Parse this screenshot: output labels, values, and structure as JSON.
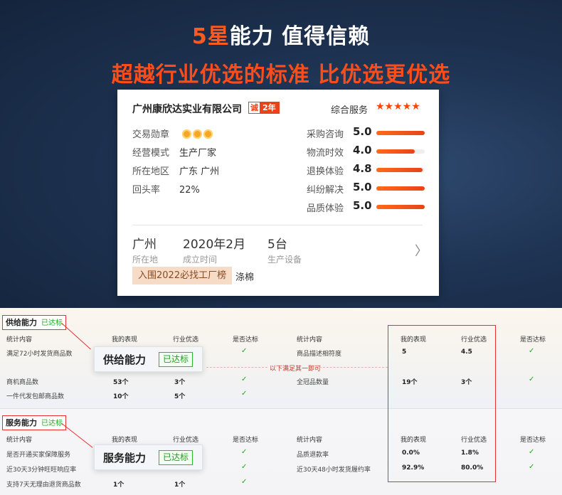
{
  "banner": {
    "headline1_accent": "5星",
    "headline1_rest": "能力 值得信赖",
    "headline2": "超越行业优选的标准  比优选更优选"
  },
  "card": {
    "company_name": "广州康欣达实业有限公司",
    "badge_cheng": "诚",
    "badge_years": "2年",
    "service_label": "综合服务",
    "service_stars": "★★★★★",
    "info": [
      {
        "key": "交易勋章",
        "value": ""
      },
      {
        "key": "经营模式",
        "value": "生产厂家"
      },
      {
        "key": "所在地区",
        "value": "广东 广州"
      },
      {
        "key": "回头率",
        "value": "22%"
      }
    ],
    "medal_count": 3,
    "scores": [
      {
        "label": "采购咨询",
        "value": "5.0",
        "fraction": 1.0
      },
      {
        "label": "物流时效",
        "value": "4.0",
        "fraction": 0.8
      },
      {
        "label": "退换体验",
        "value": "4.8",
        "fraction": 0.96
      },
      {
        "label": "纠纷解决",
        "value": "5.0",
        "fraction": 1.0
      },
      {
        "label": "品质体验",
        "value": "5.0",
        "fraction": 1.0
      }
    ],
    "meta": [
      {
        "value": "广州",
        "label": "所在地"
      },
      {
        "value": "2020年2月",
        "label": "成立时间"
      },
      {
        "value": "5台",
        "label": "生产设备"
      }
    ],
    "rank_tag": "入围2022必找工厂榜",
    "material": "涤棉"
  },
  "supply": {
    "tag": "供给能力",
    "tag_status": "已达标",
    "callout_title": "供给能力",
    "callout_badge": "已达标",
    "headers": [
      "统计内容",
      "我的表现",
      "行业优选",
      "是否达标",
      "统计内容",
      "我的表现",
      "行业优选",
      "是否达标"
    ],
    "note": "以下满足其一即可",
    "left_rows": [
      {
        "item": "满足72小时发货商品数",
        "mine": "",
        "industry": "",
        "pass": "✓"
      },
      {
        "item": "商机商品数",
        "mine": "53个",
        "industry": "3个",
        "pass": "✓"
      },
      {
        "item": "一件代发包邮商品数",
        "mine": "10个",
        "industry": "5个",
        "pass": "✓"
      }
    ],
    "right_rows": [
      {
        "item": "商品描述相符度",
        "mine": "5",
        "industry": "4.5",
        "pass": "✓"
      },
      {
        "item": "全冠品数量",
        "mine": "19个",
        "industry": "3个",
        "pass": "✓"
      }
    ]
  },
  "service": {
    "tag": "服务能力",
    "tag_status": "已达标",
    "callout_title": "服务能力",
    "callout_badge": "已达标",
    "headers": [
      "统计内容",
      "我的表现",
      "行业优选",
      "是否达标",
      "统计内容",
      "我的表现",
      "行业优选",
      "是否达标"
    ],
    "left_rows": [
      {
        "item": "是否开通买家保障服务",
        "mine": "",
        "industry": "",
        "pass": "✓"
      },
      {
        "item": "近30天3分钟旺旺响应率",
        "mine": "",
        "industry": "",
        "pass": "✓"
      },
      {
        "item": "支持7天无理由退货商品数",
        "mine": "1个",
        "industry": "1个",
        "pass": "✓"
      }
    ],
    "right_rows": [
      {
        "item": "品质退款率",
        "mine": "0.0%",
        "industry": "1.8%",
        "pass": "✓"
      },
      {
        "item": "近30天48小时发货履约率",
        "mine": "92.9%",
        "industry": "80.0%",
        "pass": "✓"
      }
    ]
  }
}
